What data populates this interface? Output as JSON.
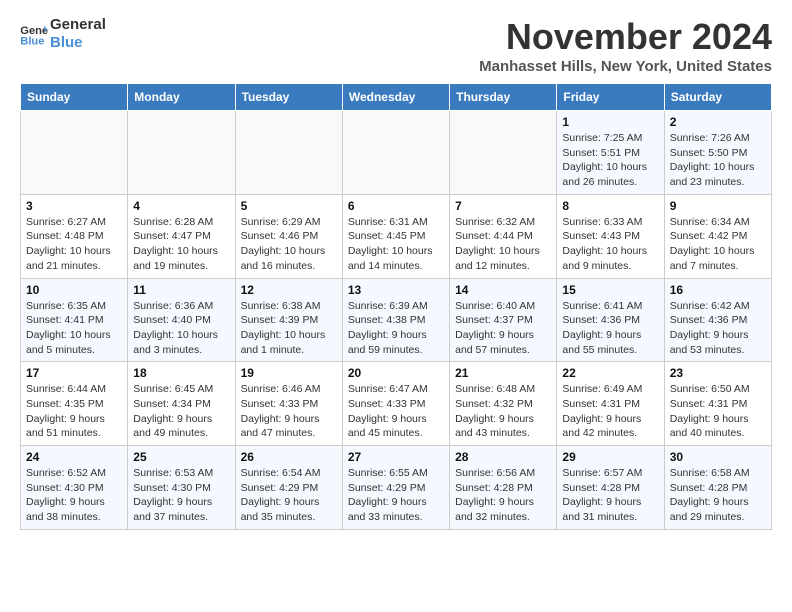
{
  "logo": {
    "line1": "General",
    "line2": "Blue"
  },
  "title": "November 2024",
  "location": "Manhasset Hills, New York, United States",
  "days_of_week": [
    "Sunday",
    "Monday",
    "Tuesday",
    "Wednesday",
    "Thursday",
    "Friday",
    "Saturday"
  ],
  "weeks": [
    [
      {
        "day": "",
        "info": ""
      },
      {
        "day": "",
        "info": ""
      },
      {
        "day": "",
        "info": ""
      },
      {
        "day": "",
        "info": ""
      },
      {
        "day": "",
        "info": ""
      },
      {
        "day": "1",
        "info": "Sunrise: 7:25 AM\nSunset: 5:51 PM\nDaylight: 10 hours and 26 minutes."
      },
      {
        "day": "2",
        "info": "Sunrise: 7:26 AM\nSunset: 5:50 PM\nDaylight: 10 hours and 23 minutes."
      }
    ],
    [
      {
        "day": "3",
        "info": "Sunrise: 6:27 AM\nSunset: 4:48 PM\nDaylight: 10 hours and 21 minutes."
      },
      {
        "day": "4",
        "info": "Sunrise: 6:28 AM\nSunset: 4:47 PM\nDaylight: 10 hours and 19 minutes."
      },
      {
        "day": "5",
        "info": "Sunrise: 6:29 AM\nSunset: 4:46 PM\nDaylight: 10 hours and 16 minutes."
      },
      {
        "day": "6",
        "info": "Sunrise: 6:31 AM\nSunset: 4:45 PM\nDaylight: 10 hours and 14 minutes."
      },
      {
        "day": "7",
        "info": "Sunrise: 6:32 AM\nSunset: 4:44 PM\nDaylight: 10 hours and 12 minutes."
      },
      {
        "day": "8",
        "info": "Sunrise: 6:33 AM\nSunset: 4:43 PM\nDaylight: 10 hours and 9 minutes."
      },
      {
        "day": "9",
        "info": "Sunrise: 6:34 AM\nSunset: 4:42 PM\nDaylight: 10 hours and 7 minutes."
      }
    ],
    [
      {
        "day": "10",
        "info": "Sunrise: 6:35 AM\nSunset: 4:41 PM\nDaylight: 10 hours and 5 minutes."
      },
      {
        "day": "11",
        "info": "Sunrise: 6:36 AM\nSunset: 4:40 PM\nDaylight: 10 hours and 3 minutes."
      },
      {
        "day": "12",
        "info": "Sunrise: 6:38 AM\nSunset: 4:39 PM\nDaylight: 10 hours and 1 minute."
      },
      {
        "day": "13",
        "info": "Sunrise: 6:39 AM\nSunset: 4:38 PM\nDaylight: 9 hours and 59 minutes."
      },
      {
        "day": "14",
        "info": "Sunrise: 6:40 AM\nSunset: 4:37 PM\nDaylight: 9 hours and 57 minutes."
      },
      {
        "day": "15",
        "info": "Sunrise: 6:41 AM\nSunset: 4:36 PM\nDaylight: 9 hours and 55 minutes."
      },
      {
        "day": "16",
        "info": "Sunrise: 6:42 AM\nSunset: 4:36 PM\nDaylight: 9 hours and 53 minutes."
      }
    ],
    [
      {
        "day": "17",
        "info": "Sunrise: 6:44 AM\nSunset: 4:35 PM\nDaylight: 9 hours and 51 minutes."
      },
      {
        "day": "18",
        "info": "Sunrise: 6:45 AM\nSunset: 4:34 PM\nDaylight: 9 hours and 49 minutes."
      },
      {
        "day": "19",
        "info": "Sunrise: 6:46 AM\nSunset: 4:33 PM\nDaylight: 9 hours and 47 minutes."
      },
      {
        "day": "20",
        "info": "Sunrise: 6:47 AM\nSunset: 4:33 PM\nDaylight: 9 hours and 45 minutes."
      },
      {
        "day": "21",
        "info": "Sunrise: 6:48 AM\nSunset: 4:32 PM\nDaylight: 9 hours and 43 minutes."
      },
      {
        "day": "22",
        "info": "Sunrise: 6:49 AM\nSunset: 4:31 PM\nDaylight: 9 hours and 42 minutes."
      },
      {
        "day": "23",
        "info": "Sunrise: 6:50 AM\nSunset: 4:31 PM\nDaylight: 9 hours and 40 minutes."
      }
    ],
    [
      {
        "day": "24",
        "info": "Sunrise: 6:52 AM\nSunset: 4:30 PM\nDaylight: 9 hours and 38 minutes."
      },
      {
        "day": "25",
        "info": "Sunrise: 6:53 AM\nSunset: 4:30 PM\nDaylight: 9 hours and 37 minutes."
      },
      {
        "day": "26",
        "info": "Sunrise: 6:54 AM\nSunset: 4:29 PM\nDaylight: 9 hours and 35 minutes."
      },
      {
        "day": "27",
        "info": "Sunrise: 6:55 AM\nSunset: 4:29 PM\nDaylight: 9 hours and 33 minutes."
      },
      {
        "day": "28",
        "info": "Sunrise: 6:56 AM\nSunset: 4:28 PM\nDaylight: 9 hours and 32 minutes."
      },
      {
        "day": "29",
        "info": "Sunrise: 6:57 AM\nSunset: 4:28 PM\nDaylight: 9 hours and 31 minutes."
      },
      {
        "day": "30",
        "info": "Sunrise: 6:58 AM\nSunset: 4:28 PM\nDaylight: 9 hours and 29 minutes."
      }
    ]
  ]
}
